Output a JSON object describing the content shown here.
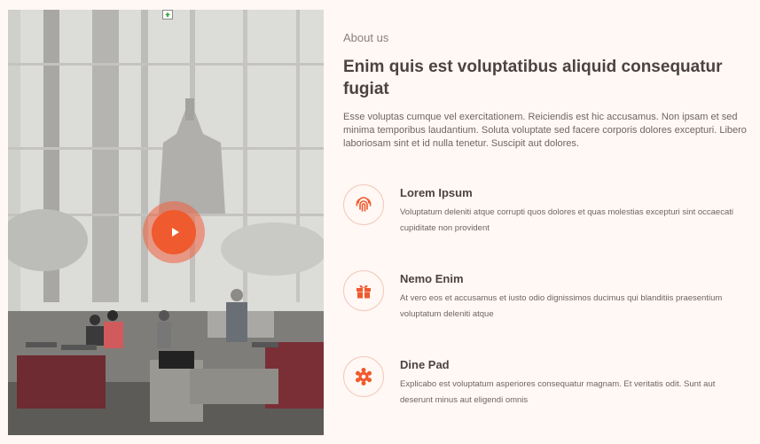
{
  "colors": {
    "accent": "#ef5a2e",
    "background": "#fff8f5",
    "heading": "#4a4342",
    "text": "#6d6563"
  },
  "about": {
    "eyebrow": "About us",
    "title": "Enim quis est voluptatibus aliquid consequatur fugiat",
    "intro": "Esse voluptas cumque vel exercitationem. Reiciendis est hic accusamus. Non ipsam et sed minima temporibus laudantium. Soluta voluptate sed facere corporis dolores excepturi. Libero laboriosam sint et id nulla tenetur. Suscipit aut dolores."
  },
  "features": [
    {
      "icon": "fingerprint-icon",
      "title": "Lorem Ipsum",
      "description": "Voluptatum deleniti atque corrupti quos dolores et quas molestias excepturi sint occaecati cupiditate non provident"
    },
    {
      "icon": "gift-icon",
      "title": "Nemo Enim",
      "description": "At vero eos et accusamus et iusto odio dignissimos ducimus qui blanditiis praesentium voluptatum deleniti atque"
    },
    {
      "icon": "atom-icon",
      "title": "Dine Pad",
      "description": "Explicabo est voluptatum asperiores consequatur magnam. Et veritatis odit. Sunt aut deserunt minus aut eligendi omnis"
    }
  ]
}
